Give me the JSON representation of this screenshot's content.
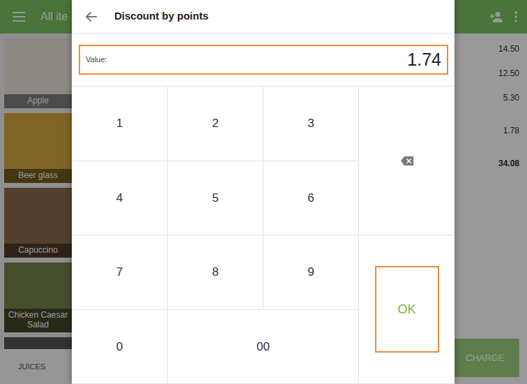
{
  "app_bar": {
    "title": "All ite"
  },
  "products": [
    {
      "name": "Apple"
    },
    {
      "name": "Beer glass"
    },
    {
      "name": "Capuccino"
    },
    {
      "name": "Chicken Caesar Salad"
    }
  ],
  "category_tabs": [
    {
      "label": "JUICES"
    }
  ],
  "receipt": {
    "items": [
      "14.50",
      "12.50",
      "5.30"
    ],
    "extra": "1.78",
    "total": "34.08"
  },
  "charge_button": {
    "label": "CHARGE"
  },
  "dialog": {
    "title": "Discount by points",
    "field": {
      "label": "Value:",
      "value": "1.74",
      "highlighted": true
    },
    "keys": [
      {
        "label": "1",
        "kind": "digit",
        "highlighted": false
      },
      {
        "label": "2",
        "kind": "digit",
        "highlighted": false
      },
      {
        "label": "3",
        "kind": "digit",
        "highlighted": false
      },
      {
        "kind": "backspace",
        "highlighted": false
      },
      {
        "label": "4",
        "kind": "digit",
        "highlighted": false
      },
      {
        "label": "5",
        "kind": "digit",
        "highlighted": false
      },
      {
        "label": "6",
        "kind": "digit",
        "highlighted": false
      },
      {
        "label": "7",
        "kind": "digit",
        "highlighted": false
      },
      {
        "label": "8",
        "kind": "digit",
        "highlighted": false
      },
      {
        "label": "9",
        "kind": "digit",
        "highlighted": false
      },
      {
        "label": "OK",
        "kind": "confirm",
        "highlighted": true
      },
      {
        "label": "0",
        "kind": "digit",
        "highlighted": false
      },
      {
        "label": "00",
        "kind": "wide",
        "highlighted": false
      }
    ]
  }
}
